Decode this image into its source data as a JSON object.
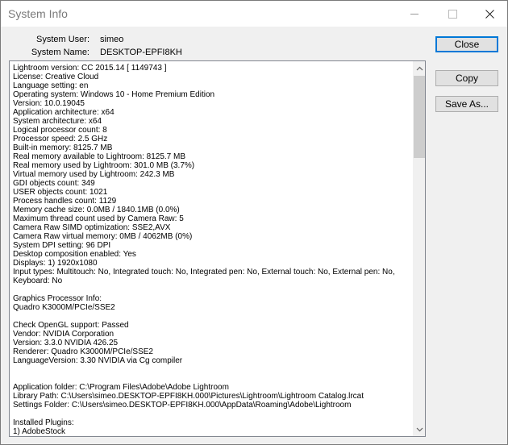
{
  "window": {
    "title": "System Info",
    "controls": {
      "minimize_icon": "minimize-icon",
      "maximize_icon": "maximize-icon",
      "close_icon": "close-icon"
    }
  },
  "header": {
    "user_label": "System User:",
    "user_value": "simeo",
    "name_label": "System Name:",
    "name_value": "DESKTOP-EPFI8KH"
  },
  "buttons": {
    "close": "Close",
    "copy": "Copy",
    "save_as": "Save As..."
  },
  "info_lines": [
    "Lightroom version: CC 2015.14 [ 1149743 ]",
    "License: Creative Cloud",
    "Language setting: en",
    "Operating system: Windows 10 - Home Premium Edition",
    "Version: 10.0.19045",
    "Application architecture: x64",
    "System architecture: x64",
    "Logical processor count: 8",
    "Processor speed: 2.5 GHz",
    "Built-in memory: 8125.7 MB",
    "Real memory available to Lightroom: 8125.7 MB",
    "Real memory used by Lightroom: 301.0 MB (3.7%)",
    "Virtual memory used by Lightroom: 242.3 MB",
    "GDI objects count: 349",
    "USER objects count: 1021",
    "Process handles count: 1129",
    "Memory cache size: 0.0MB / 1840.1MB (0.0%)",
    "Maximum thread count used by Camera Raw: 5",
    "Camera Raw SIMD optimization: SSE2,AVX",
    "Camera Raw virtual memory: 0MB / 4062MB (0%)",
    "System DPI setting: 96 DPI",
    "Desktop composition enabled: Yes",
    "Displays: 1) 1920x1080",
    "Input types: Multitouch: No, Integrated touch: No, Integrated pen: No, External touch: No, External pen: No,",
    "Keyboard: No",
    "",
    "Graphics Processor Info:",
    "Quadro K3000M/PCIe/SSE2",
    "",
    "Check OpenGL support: Passed",
    "Vendor: NVIDIA Corporation",
    "Version: 3.3.0 NVIDIA 426.25",
    "Renderer: Quadro K3000M/PCIe/SSE2",
    "LanguageVersion: 3.30 NVIDIA via Cg compiler",
    "",
    "",
    "Application folder: C:\\Program Files\\Adobe\\Adobe Lightroom",
    "Library Path: C:\\Users\\simeo.DESKTOP-EPFI8KH.000\\Pictures\\Lightroom\\Lightroom Catalog.lrcat",
    "Settings Folder: C:\\Users\\simeo.DESKTOP-EPFI8KH.000\\AppData\\Roaming\\Adobe\\Lightroom",
    "",
    "Installed Plugins:",
    "1) AdobeStock"
  ],
  "scrollbar": {
    "up_icon": "scroll-up-arrow-icon",
    "down_icon": "scroll-down-arrow-icon"
  }
}
